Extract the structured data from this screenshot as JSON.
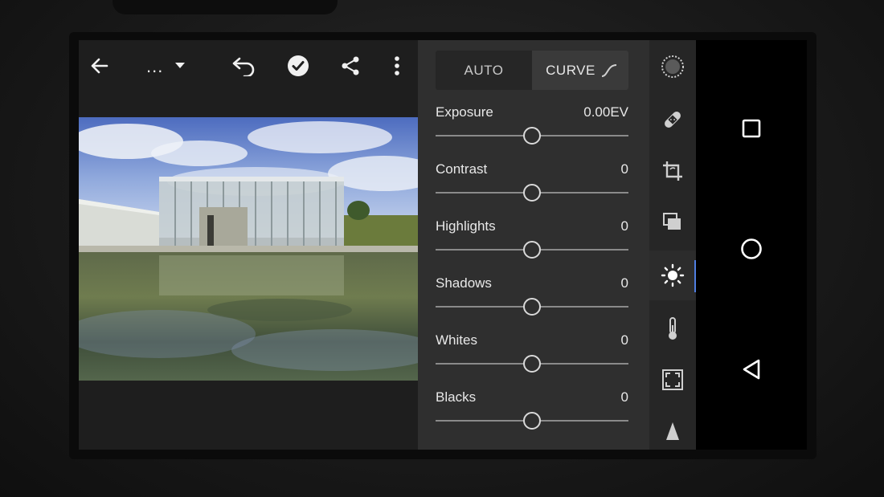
{
  "app": {
    "album_label": "...",
    "accent_color": "#4f7de0"
  },
  "toolbar": {
    "icons": [
      "back-arrow-icon",
      "dropdown-caret-icon",
      "undo-icon",
      "done-check-icon",
      "share-icon",
      "more-vert-icon"
    ]
  },
  "panel": {
    "tabs": [
      {
        "label": "AUTO",
        "active": false
      },
      {
        "label": "CURVE",
        "active": true,
        "icon": "curve-icon"
      }
    ],
    "sliders": [
      {
        "label": "Exposure",
        "value": "0.00EV",
        "position": 0.5
      },
      {
        "label": "Contrast",
        "value": "0",
        "position": 0.5
      },
      {
        "label": "Highlights",
        "value": "0",
        "position": 0.5
      },
      {
        "label": "Shadows",
        "value": "0",
        "position": 0.5
      },
      {
        "label": "Whites",
        "value": "0",
        "position": 0.5
      },
      {
        "label": "Blacks",
        "value": "0",
        "position": 0.5
      }
    ]
  },
  "tools": {
    "items": [
      "vignette-icon",
      "healing-bandage-icon",
      "crop-icon",
      "presets-icon",
      "light-sun-icon",
      "temperature-thermometer-icon",
      "effects-frame-icon",
      "detail-triangle-icon"
    ],
    "active": "light-sun-icon"
  },
  "android_nav": {
    "buttons": [
      "recent-apps-square-icon",
      "home-circle-icon",
      "back-triangle-icon"
    ]
  }
}
